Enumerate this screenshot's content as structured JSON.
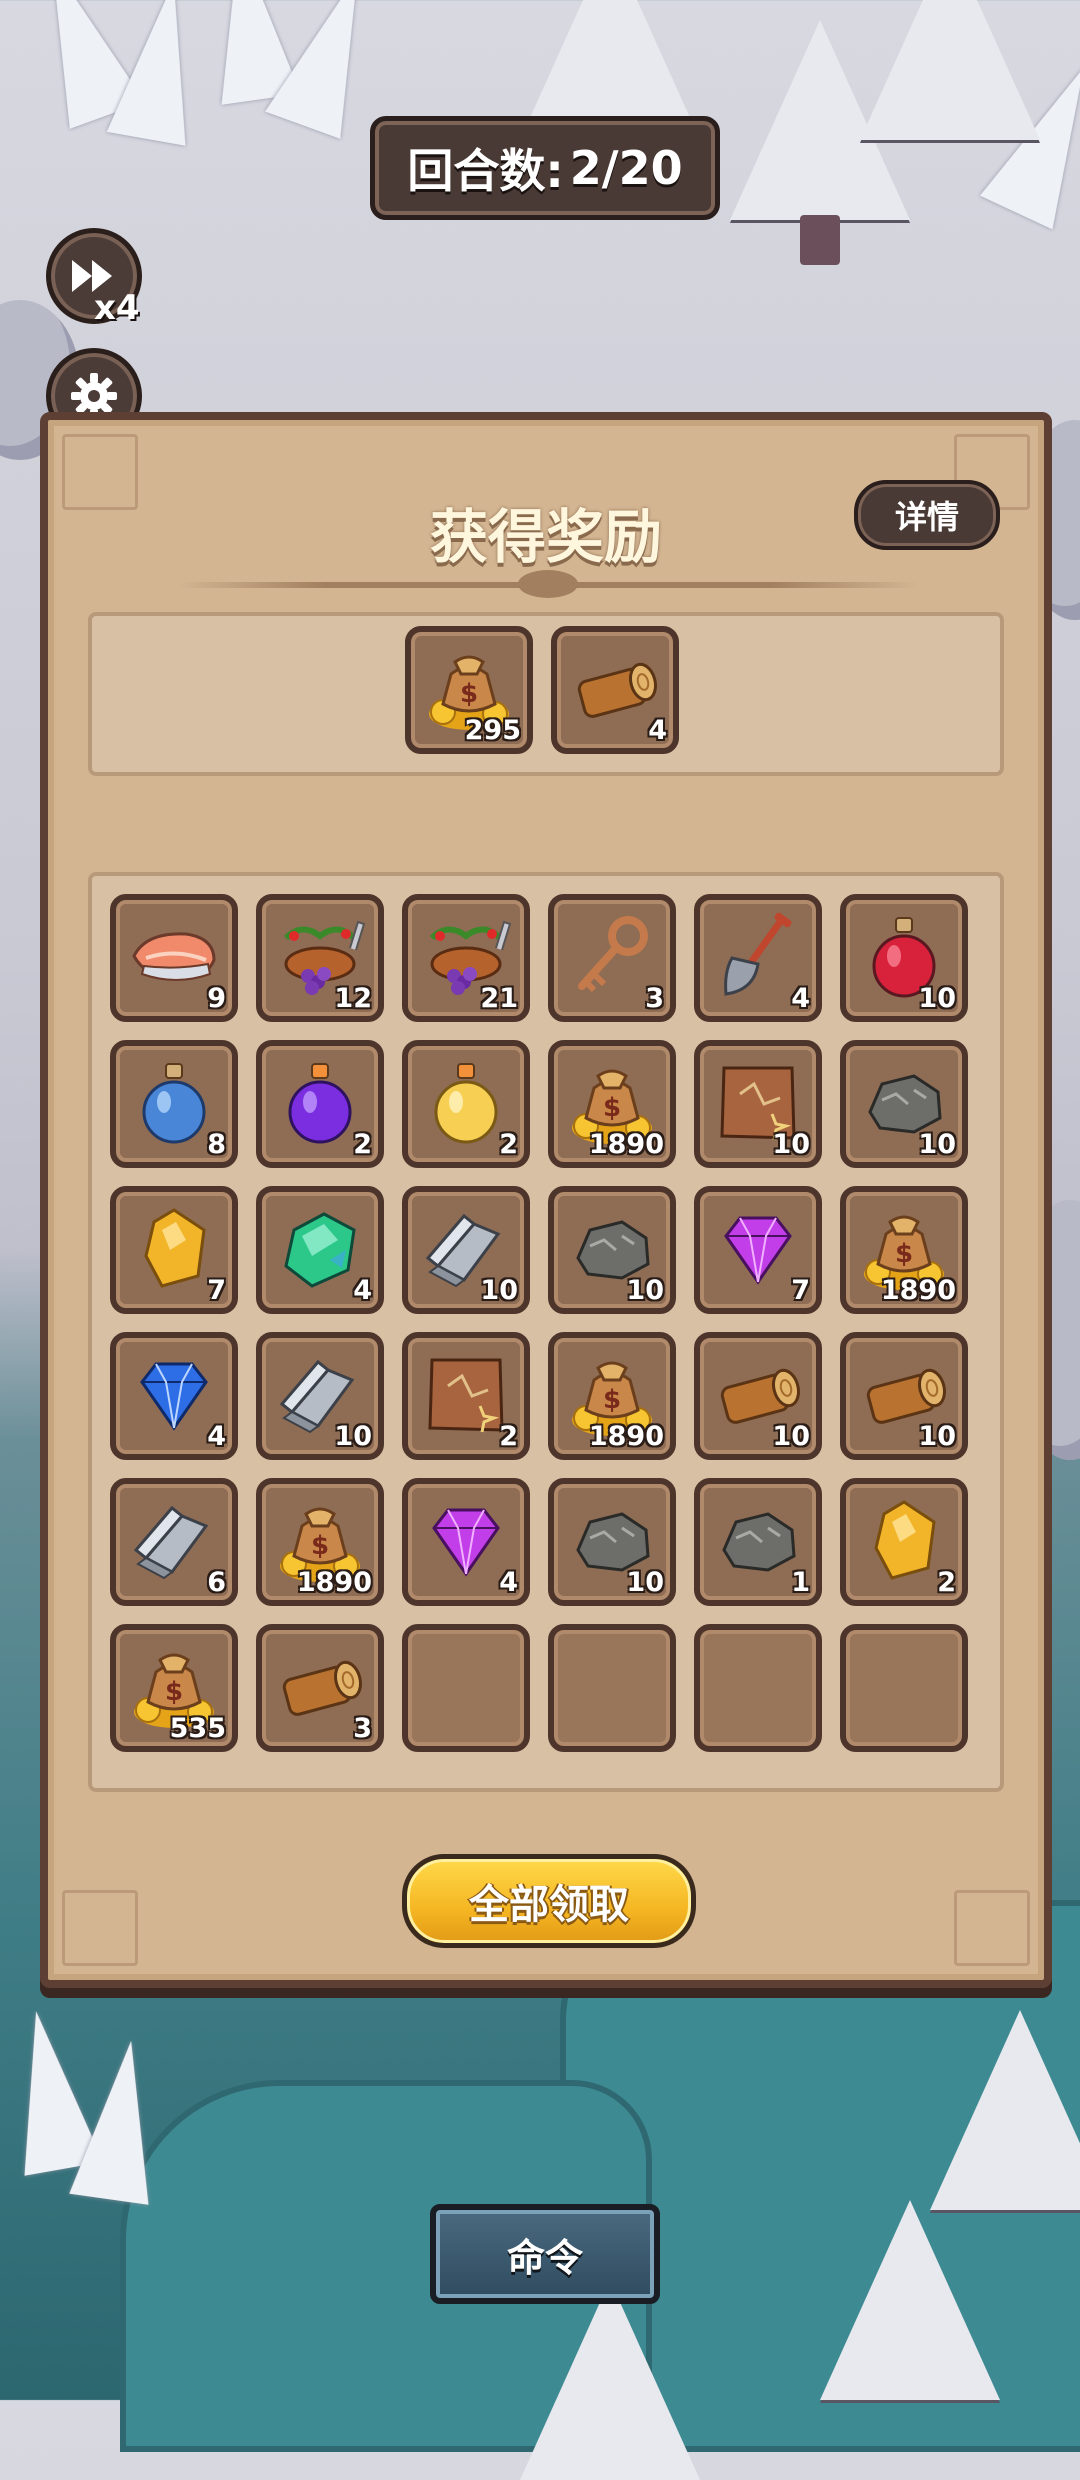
{
  "hud": {
    "round_label": "回合数:",
    "round_value": "2/20",
    "speed_label": "x4"
  },
  "panel": {
    "title": "获得奖励",
    "detail_button": "详情",
    "claim_all_button": "全部领取"
  },
  "top_rewards": [
    {
      "icon": "gold-bag",
      "count": "295"
    },
    {
      "icon": "wood-log",
      "count": "4"
    }
  ],
  "reward_grid": [
    {
      "icon": "salmon-steak",
      "count": "9"
    },
    {
      "icon": "fruit-meat-basket",
      "count": "12"
    },
    {
      "icon": "fruit-meat-basket",
      "count": "21"
    },
    {
      "icon": "bronze-key",
      "count": "3"
    },
    {
      "icon": "shovel",
      "count": "4"
    },
    {
      "icon": "red-potion",
      "count": "10"
    },
    {
      "icon": "blue-potion",
      "count": "8"
    },
    {
      "icon": "purple-potion",
      "count": "2"
    },
    {
      "icon": "yellow-potion",
      "count": "2"
    },
    {
      "icon": "gold-bag",
      "count": "1890"
    },
    {
      "icon": "leather-hide",
      "count": "10"
    },
    {
      "icon": "stone-ore",
      "count": "10"
    },
    {
      "icon": "amber-gem",
      "count": "7"
    },
    {
      "icon": "green-crystal",
      "count": "4"
    },
    {
      "icon": "iron-ingot",
      "count": "10"
    },
    {
      "icon": "stone-ore",
      "count": "10"
    },
    {
      "icon": "purple-diamond",
      "count": "7"
    },
    {
      "icon": "gold-bag",
      "count": "1890"
    },
    {
      "icon": "blue-diamond",
      "count": "4"
    },
    {
      "icon": "iron-ingot",
      "count": "10"
    },
    {
      "icon": "leather-hide",
      "count": "2"
    },
    {
      "icon": "gold-bag",
      "count": "1890"
    },
    {
      "icon": "wood-log",
      "count": "10"
    },
    {
      "icon": "wood-log",
      "count": "10"
    },
    {
      "icon": "iron-ingot",
      "count": "6"
    },
    {
      "icon": "gold-bag",
      "count": "1890"
    },
    {
      "icon": "purple-diamond",
      "count": "4"
    },
    {
      "icon": "stone-ore",
      "count": "10"
    },
    {
      "icon": "stone-ore",
      "count": "1"
    },
    {
      "icon": "amber-gem",
      "count": "2"
    },
    {
      "icon": "gold-bag",
      "count": "535"
    },
    {
      "icon": "wood-log",
      "count": "3"
    },
    {
      "icon": "empty",
      "count": ""
    },
    {
      "icon": "empty",
      "count": ""
    },
    {
      "icon": "empty",
      "count": ""
    },
    {
      "icon": "empty",
      "count": ""
    }
  ],
  "bottom": {
    "command_button": "命令"
  },
  "colors": {
    "panel_bg": "#d3b592",
    "slot_bg": "#8f6c54",
    "claim_button": "#f5b623",
    "command_button": "#2f4b5f"
  }
}
